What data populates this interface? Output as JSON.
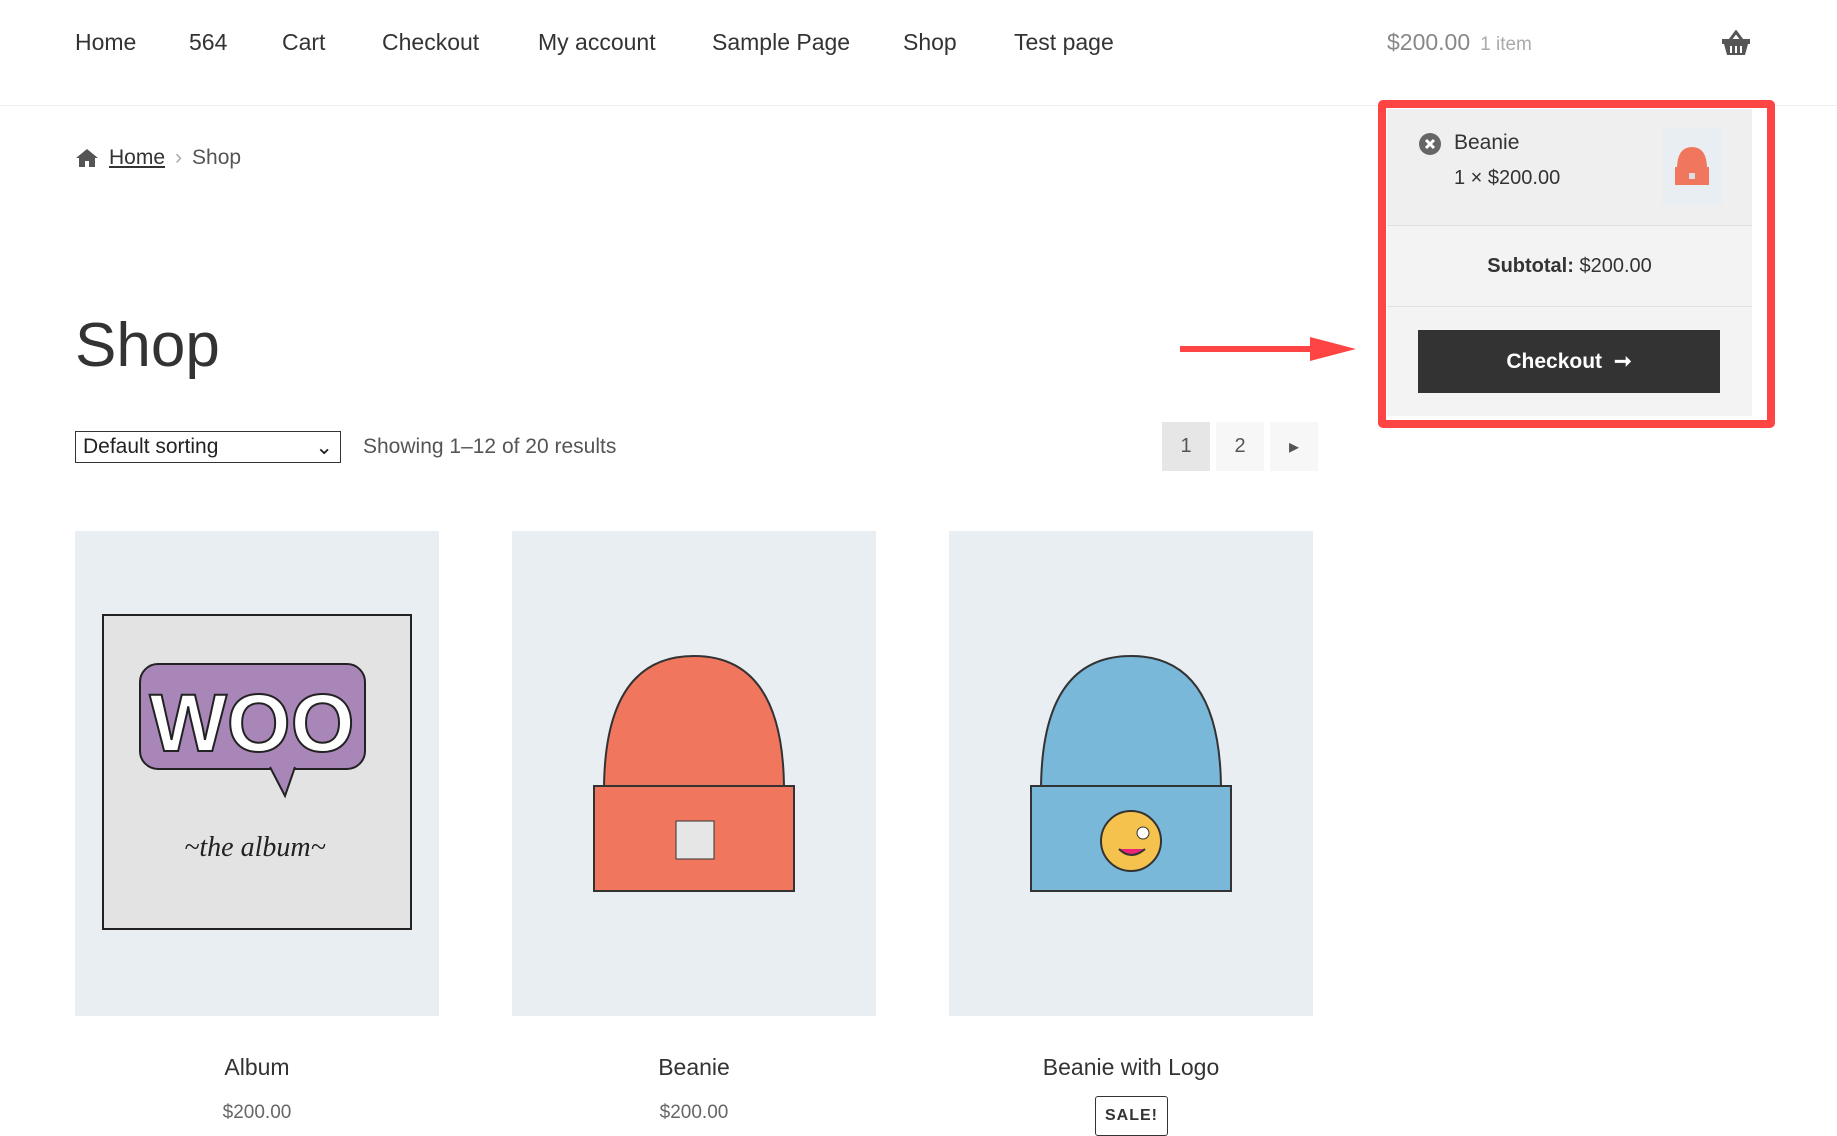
{
  "nav": {
    "items": [
      "Home",
      "564",
      "Cart",
      "Checkout",
      "My account",
      "Sample Page",
      "Shop",
      "Test page"
    ]
  },
  "header_cart": {
    "total": "$200.00",
    "count": "1 item",
    "icon": "basket-icon"
  },
  "breadcrumb": {
    "home": "Home",
    "current": "Shop",
    "icon": "home-icon"
  },
  "page_title": "Shop",
  "sorting": {
    "selected": "Default sorting"
  },
  "result_count": "Showing 1–12 of 20 results",
  "pagination": {
    "pages": [
      "1",
      "2"
    ],
    "current": "1",
    "next_icon": "caret-right-icon"
  },
  "products": [
    {
      "name": "Album",
      "price": "$200.00"
    },
    {
      "name": "Beanie",
      "price": "$200.00"
    },
    {
      "name": "Beanie with Logo",
      "badge": "SALE!"
    }
  ],
  "mini_cart": {
    "item_name": "Beanie",
    "item_qty_price": "1 × $200.00",
    "subtotal_label": "Subtotal:",
    "subtotal_value": "$200.00",
    "checkout_label": "Checkout",
    "highlight_color": "#ff4444"
  }
}
